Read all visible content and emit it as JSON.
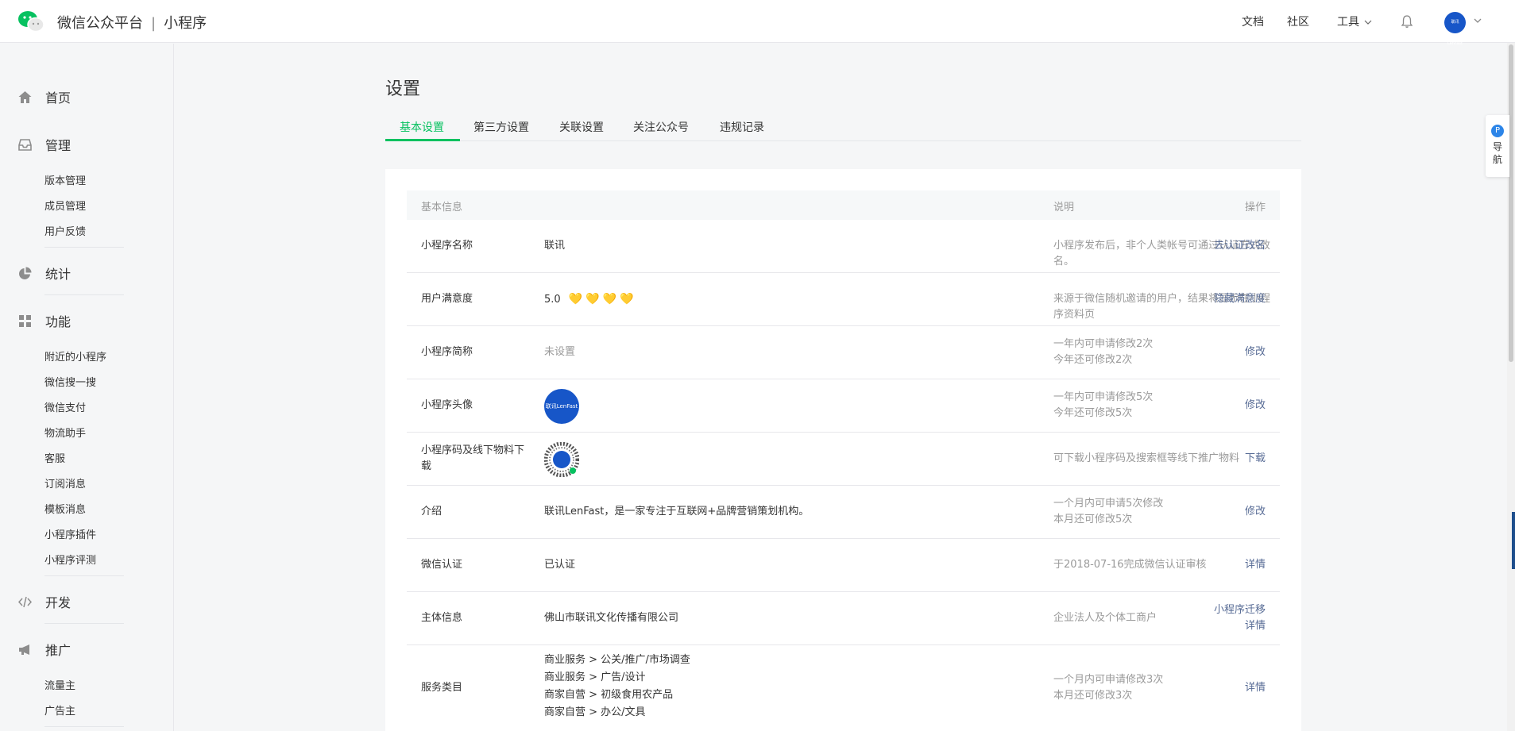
{
  "header": {
    "brand": "微信公众平台",
    "separator": "|",
    "product": "小程序",
    "nav_docs": "文档",
    "nav_community": "社区",
    "nav_tools": "工具",
    "avatar_text": "联讯LenFast"
  },
  "sidebar": {
    "home": "首页",
    "manage": "管理",
    "manage_items": [
      "版本管理",
      "成员管理",
      "用户反馈"
    ],
    "stats": "统计",
    "features": "功能",
    "feature_items": [
      "附近的小程序",
      "微信搜一搜",
      "微信支付",
      "物流助手",
      "客服",
      "订阅消息",
      "模板消息",
      "小程序插件",
      "小程序评测"
    ],
    "dev": "开发",
    "promo": "推广",
    "promo_items": [
      "流量主",
      "广告主"
    ]
  },
  "page": {
    "title": "设置",
    "tabs": [
      "基本设置",
      "第三方设置",
      "关联设置",
      "关注公众号",
      "违规记录"
    ],
    "active_tab": 0
  },
  "table": {
    "head": {
      "info": "基本信息",
      "desc": "说明",
      "op": "操作"
    },
    "rows": {
      "name": {
        "label": "小程序名称",
        "value": "联讯",
        "desc": "小程序发布后，非个人类帐号可通过认证方式改名。",
        "op": "去认证改名"
      },
      "rating": {
        "label": "用户满意度",
        "value": "5.0",
        "hearts": "💛💛💛💛",
        "rating_value": 5.0,
        "desc": "来源于微信随机邀请的用户，结果将显示在小程序资料页",
        "op": "隐藏满意度"
      },
      "short": {
        "label": "小程序简称",
        "value": "未设置",
        "desc1": "一年内可申请修改2次",
        "desc2": "今年还可修改2次",
        "op": "修改"
      },
      "avatar": {
        "label": "小程序头像",
        "img_text": "联讯LenFast",
        "desc1": "一年内可申请修改5次",
        "desc2": "今年还可修改5次",
        "op": "修改"
      },
      "code": {
        "label1": "小程序码及线下物料下",
        "label2": "载",
        "desc": "可下载小程序码及搜索框等线下推广物料",
        "op": "下载"
      },
      "intro": {
        "label": "介绍",
        "value": "联讯LenFast，是一家专注于互联网+品牌营销策划机构。",
        "desc1": "一个月内可申请5次修改",
        "desc2": "本月还可修改5次",
        "op": "修改"
      },
      "cert": {
        "label": "微信认证",
        "value": "已认证",
        "desc": "于2018-07-16完成微信认证审核",
        "op": "详情"
      },
      "subject": {
        "label": "主体信息",
        "value": "佛山市联讯文化传播有限公司",
        "desc": "企业法人及个体工商户",
        "op1": "小程序迁移",
        "op2": "详情"
      },
      "category": {
        "label": "服务类目",
        "values": [
          "商业服务 > 公关/推广/市场调查",
          "商业服务 > 广告/设计",
          "商家自营 > 初级食用农产品",
          "商家自营 > 办公/文具"
        ],
        "desc1": "一个月内可申请修改3次",
        "desc2": "本月还可修改3次",
        "op": "详情"
      }
    }
  },
  "float_nav": {
    "badge": "P",
    "label": "导航"
  },
  "colors": {
    "accent": "#07c160",
    "link": "#576b95",
    "muted": "#9a9a9a",
    "heart": "#ffc300",
    "avatar_bg": "#1756c8"
  }
}
